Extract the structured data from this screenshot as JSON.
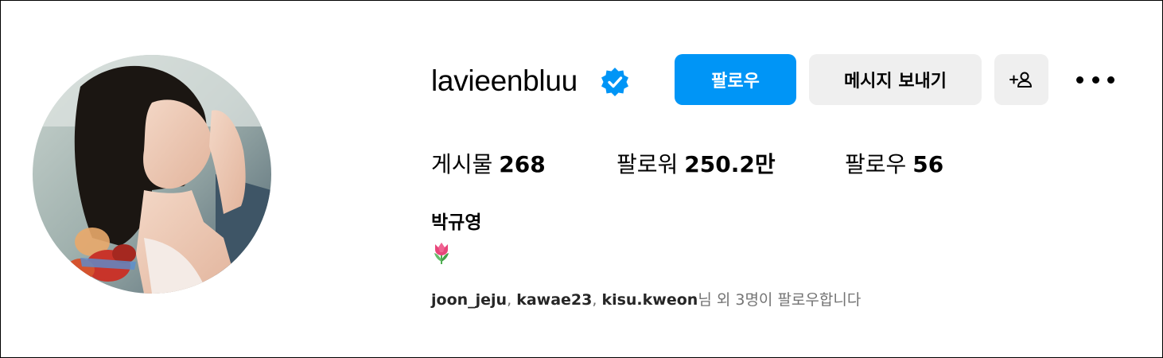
{
  "profile": {
    "username": "lavieenbluu",
    "verified_icon": "verified-badge-icon",
    "full_name": "박규영",
    "bio_emoji": "tulip",
    "avatar_alt": "profile-photo"
  },
  "actions": {
    "follow_label": "팔로우",
    "message_label": "메시지 보내기",
    "suggest_icon": "add-person-icon",
    "more_icon": "more-options-icon"
  },
  "stats": {
    "posts_label": "게시물",
    "posts_count": "268",
    "followers_label": "팔로워",
    "followers_count": "250.2만",
    "following_label": "팔로우",
    "following_count": "56"
  },
  "followed_by": {
    "users": [
      "joon_jeju",
      "kawae23",
      "kisu.kweon"
    ],
    "separator": ", ",
    "suffix": "님 외 3명이 팔로우합니다"
  },
  "colors": {
    "primary": "#0095f6",
    "secondary_button": "#efefef",
    "muted_text": "#737373"
  }
}
